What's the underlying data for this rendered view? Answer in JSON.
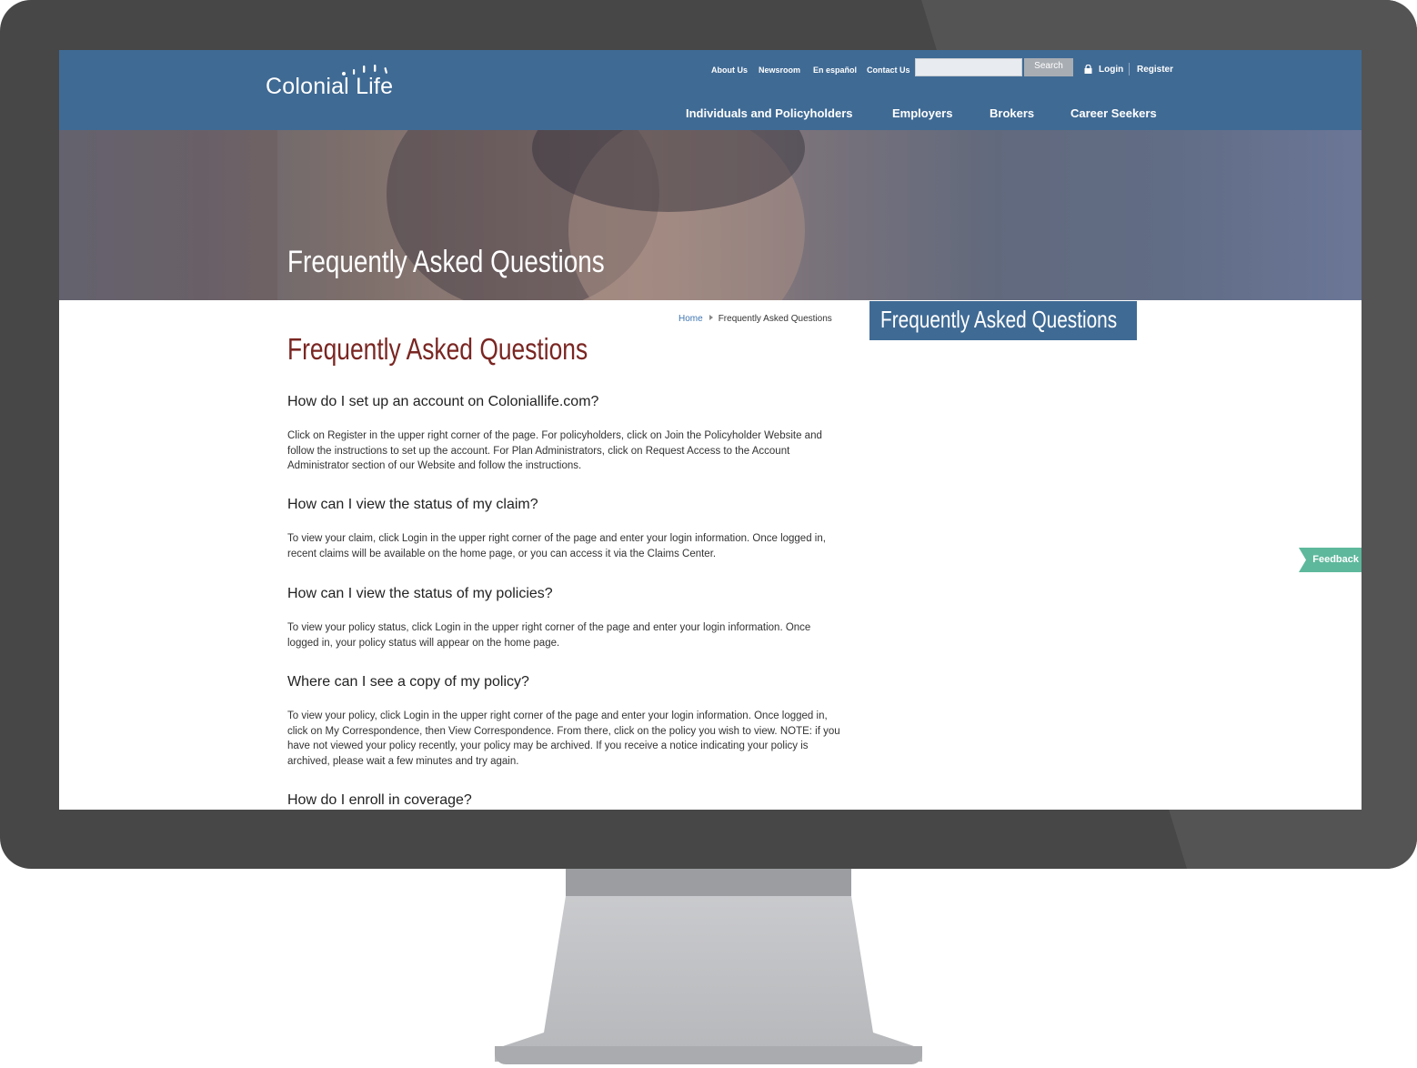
{
  "brand": {
    "logo_text": "Colonial Life"
  },
  "utility_nav": {
    "about": "About Us",
    "newsroom": "Newsroom",
    "espanol": "En español",
    "contact": "Contact Us",
    "search_button": "Search",
    "search_value": "",
    "login": "Login",
    "register": "Register"
  },
  "main_nav": {
    "individuals": "Individuals and Policyholders",
    "employers": "Employers",
    "brokers": "Brokers",
    "career": "Career Seekers"
  },
  "hero": {
    "title": "Frequently Asked Questions"
  },
  "breadcrumb": {
    "home": "Home",
    "current": "Frequently Asked Questions"
  },
  "page_title": "Frequently Asked Questions",
  "faqs": [
    {
      "q": "How do I set up an account on Coloniallife.com?",
      "a": "Click on Register in the upper right corner of the page. For policyholders, click on Join the Policyholder Website and follow the instructions to set up the account. For Plan Administrators, click on Request Access to the Account Administrator section of our Website and follow the instructions."
    },
    {
      "q": "How can I view the status of my claim?",
      "a": "To view your claim, click Login in the upper right corner of the page and enter your login information. Once logged in, recent claims will be available on the home page, or you can access it via the Claims Center."
    },
    {
      "q": "How can I view the status of my policies?",
      "a": "To view your policy status, click Login in the upper right corner of the page and enter your login information. Once logged in, your policy status will appear on the home page."
    },
    {
      "q": "Where can I see a copy of my policy?",
      "a": "To view your policy, click Login in the upper right corner of the page and enter your login information. Once logged in, click on My Correspondence, then View Correspondence. From there, click on the policy you wish to view. NOTE: if you have not viewed your policy recently, your policy may be archived. If you receive a notice indicating your policy is archived, please wait a few minutes and try again."
    },
    {
      "q": "How do I enroll in coverage?",
      "a": ""
    }
  ],
  "sidebar": {
    "title": "Frequently Asked Questions"
  },
  "feedback": {
    "label": "Feedback"
  },
  "colors": {
    "header": "#3f6a94",
    "title_red": "#7a2622",
    "feedback_green": "#5eb89c",
    "link_blue": "#3f76b1"
  }
}
